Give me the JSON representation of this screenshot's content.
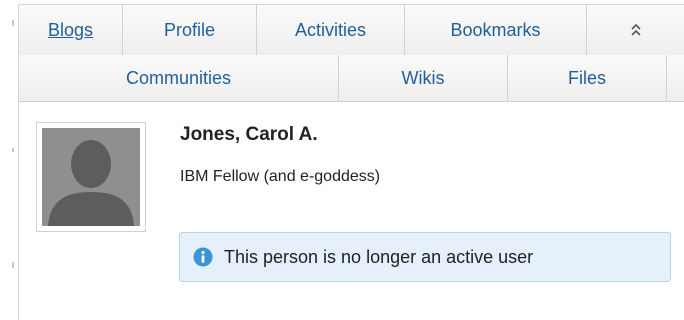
{
  "nav": {
    "row1": [
      {
        "label": "Blogs",
        "active": true
      },
      {
        "label": "Profile",
        "active": false
      },
      {
        "label": "Activities",
        "active": false
      },
      {
        "label": "Bookmarks",
        "active": false
      }
    ],
    "row2": [
      {
        "label": "Communities"
      },
      {
        "label": "Wikis"
      },
      {
        "label": "Files"
      }
    ],
    "collapse_icon": "collapse-up-icon"
  },
  "profile": {
    "name": "Jones, Carol A.",
    "title": "IBM Fellow (and e-goddess)",
    "avatar_icon": "default-person-avatar"
  },
  "notice": {
    "icon": "info-icon",
    "text": "This person is no longer an active user"
  },
  "colors": {
    "link": "#1f5f9e",
    "notice_bg": "#e5f0fa",
    "notice_border": "#b8d3ea",
    "info_icon": "#3a95d6",
    "avatar_bg": "#8f8f8f"
  }
}
